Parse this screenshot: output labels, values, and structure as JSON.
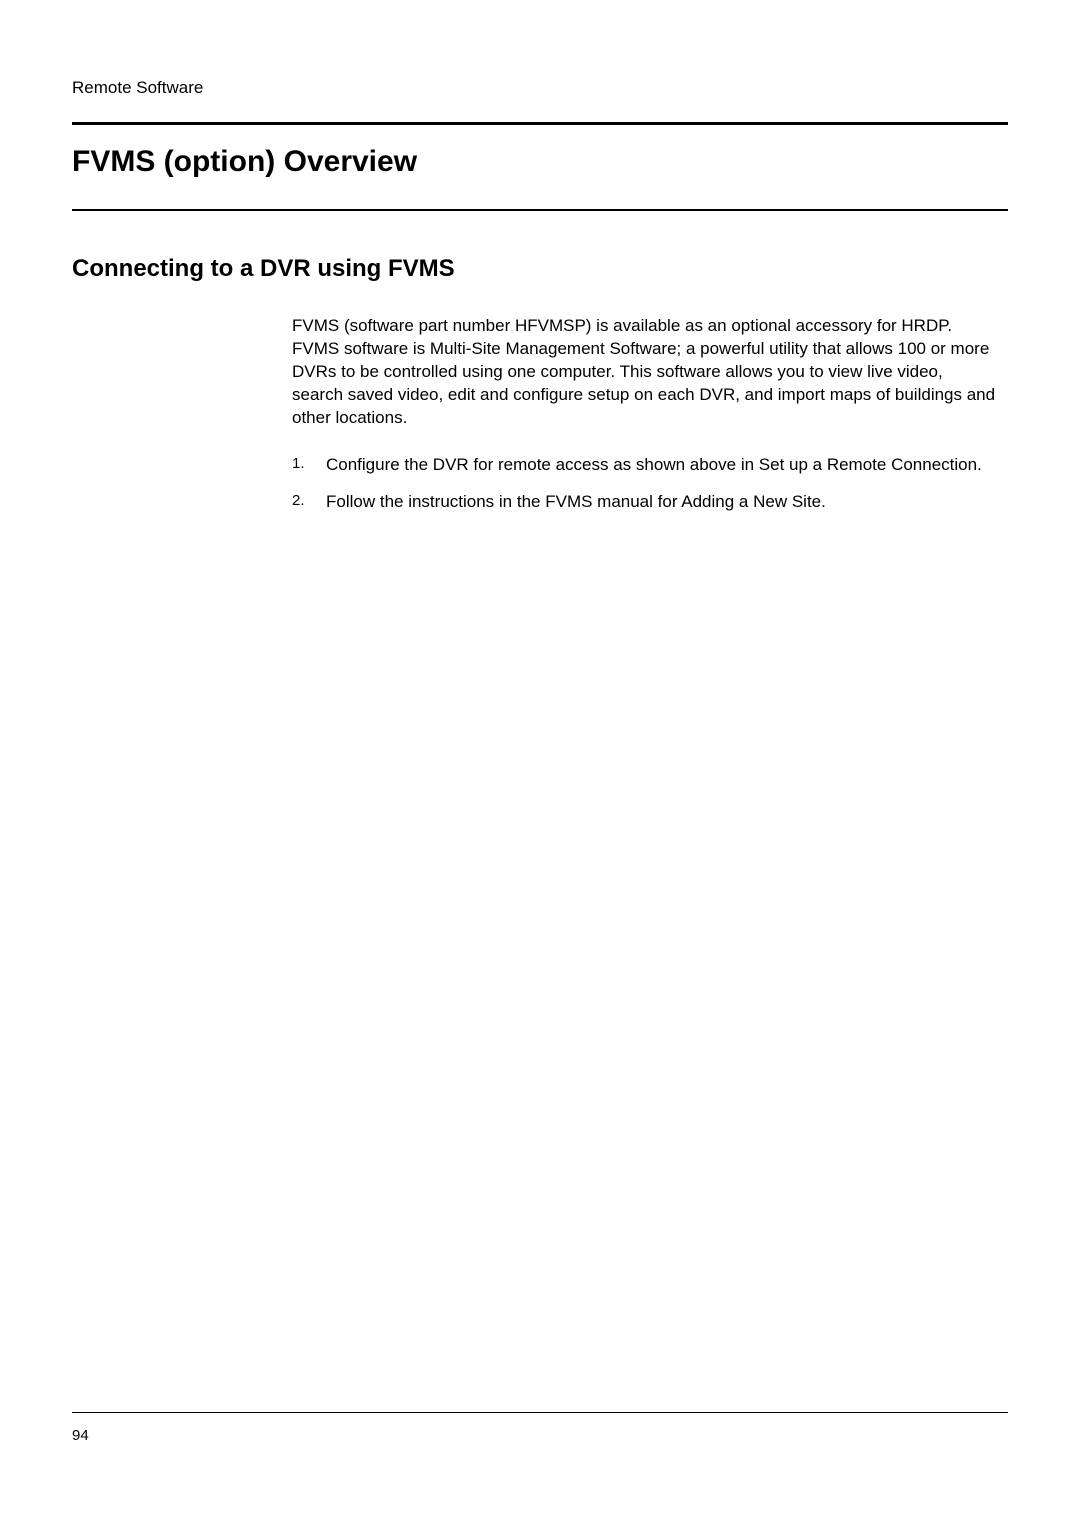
{
  "header": {
    "section": "Remote Software"
  },
  "title": "FVMS (option) Overview",
  "subtitle": "Connecting to a DVR using FVMS",
  "paragraph": "FVMS (software part number HFVMSP) is available as an optional accessory for HRDP. FVMS software is Multi-Site Management Software; a powerful utility that allows 100 or more DVRs to be controlled using one computer. This software allows you to view live video, search saved video, edit and configure setup on each DVR, and import maps of buildings and other locations.",
  "list": [
    {
      "num": "1.",
      "text": "Configure the DVR for remote access as shown above in Set up a Remote Connection."
    },
    {
      "num": "2.",
      "text": "Follow the instructions in the FVMS manual for Adding a New Site."
    }
  ],
  "footer": {
    "pageNumber": "94"
  }
}
